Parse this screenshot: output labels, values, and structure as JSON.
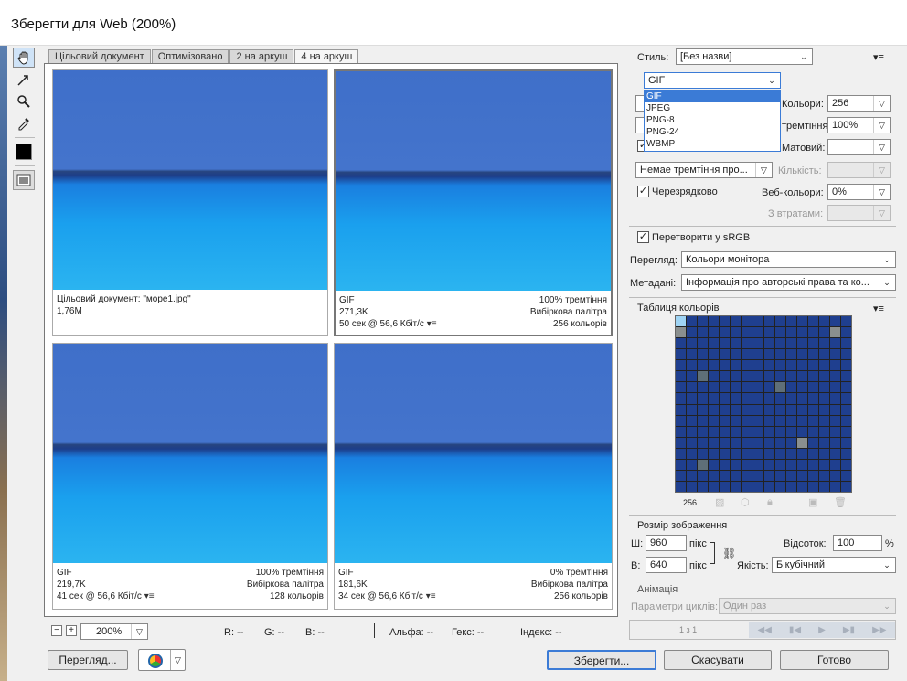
{
  "window": {
    "title": "Зберегти для Web (200%)"
  },
  "tabs": [
    "Цільовий документ",
    "Оптимізовано",
    "2 на аркуш",
    "4 на аркуш"
  ],
  "panes": [
    {
      "line1_left": "Цільовий документ: \"море1.jpg\"",
      "line1_right": "",
      "line2_left": "1,76M",
      "line2_right": "",
      "line3_left": "",
      "line3_right": ""
    },
    {
      "line1_left": "GIF",
      "line1_right": "100% тремтіння",
      "line2_left": "271,3K",
      "line2_right": "Вибіркова палітра",
      "line3_left": "50 сек @ 56,6 Кбіт/с",
      "line3_right": "256 кольорів"
    },
    {
      "line1_left": "GIF",
      "line1_right": "100% тремтіння",
      "line2_left": "219,7K",
      "line2_right": "Вибіркова палітра",
      "line3_left": "41 сек @ 56,6 Кбіт/с",
      "line3_right": "128 кольорів"
    },
    {
      "line1_left": "GIF",
      "line1_right": "0% тремтіння",
      "line2_left": "181,6K",
      "line2_right": "Вибіркова палітра",
      "line3_left": "34 сек @ 56,6 Кбіт/с",
      "line3_right": "256 кольорів"
    }
  ],
  "status": {
    "zoom": "200%",
    "r": "R: --",
    "g": "G: --",
    "b": "B: --",
    "alpha": "Альфа: --",
    "hex": "Гекс: --",
    "index": "Індекс: --"
  },
  "bottom": {
    "preview": "Перегляд...",
    "save": "Зберегти...",
    "cancel": "Скасувати",
    "done": "Готово"
  },
  "settings": {
    "style_label": "Стиль:",
    "style_value": "[Без назви]",
    "format_value": "GIF",
    "format_options": [
      "GIF",
      "JPEG",
      "PNG-8",
      "PNG-24",
      "WBMP"
    ],
    "colors_label": "Кольори:",
    "colors_value": "256",
    "dither_label": "тремтіння:",
    "dither_value": "100%",
    "matte_label": "Матовий:",
    "matte_value": "",
    "transparency_dither": "Немае тремтіння про...",
    "amount_label": "Кількість:",
    "amount_value": "",
    "interlaced_label": "Черезрядково",
    "web_colors_label": "Веб-кольори:",
    "web_colors_value": "0%",
    "lossy_label": "З втратами:",
    "lossy_value": "",
    "srgb_label": "Перетворити у sRGB",
    "preview_label": "Перегляд:",
    "preview_value": "Кольори монітора",
    "metadata_label": "Метадані:",
    "metadata_value": "Інформація про авторські права та ко..."
  },
  "color_table": {
    "title": "Таблиця кольорів",
    "count": "256"
  },
  "image_size": {
    "title": "Розмір зображення",
    "w_label": "Ш:",
    "w_value": "960",
    "h_label": "В:",
    "h_value": "640",
    "unit": "пікс",
    "percent_label": "Відсоток:",
    "percent_value": "100",
    "percent_unit": "%",
    "quality_label": "Якість:",
    "quality_value": "Бікубічний"
  },
  "animation": {
    "title": "Анімація",
    "loop_label": "Параметри циклів:",
    "loop_value": "Один раз",
    "frame": "1 з 1"
  },
  "colors": {
    "accent": "#3b7bd6",
    "sky": "#3f6fc9",
    "sea": "#1f8fe0"
  }
}
